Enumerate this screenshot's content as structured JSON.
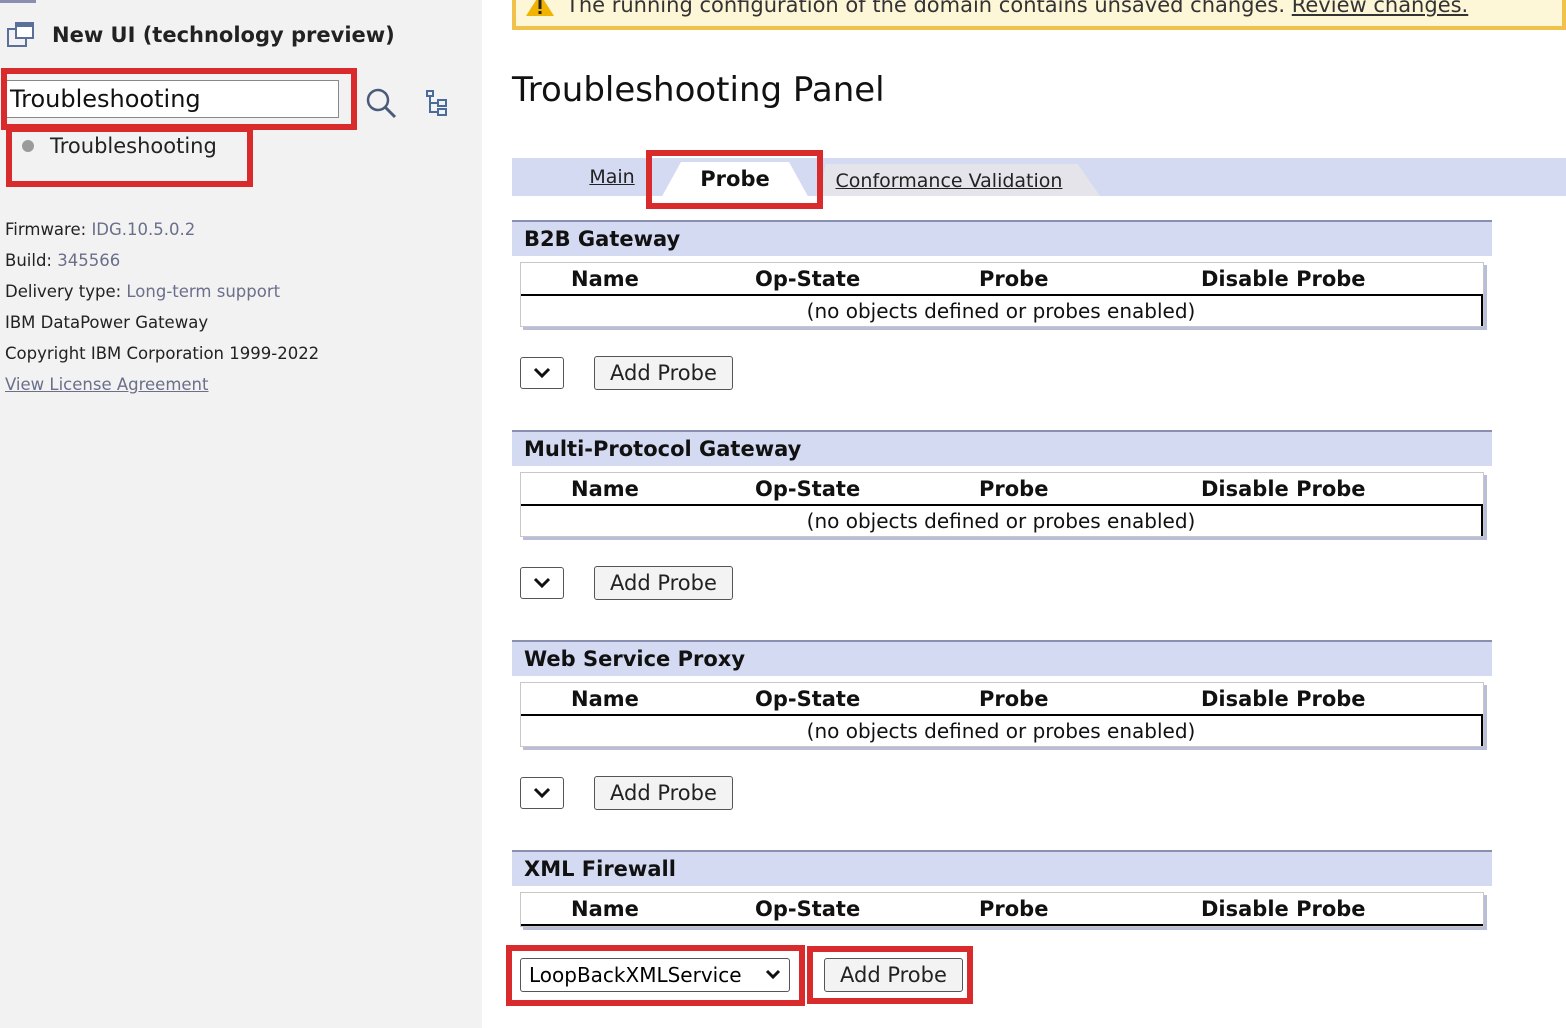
{
  "sidebar": {
    "title": "New UI (technology preview)",
    "search": {
      "value": "Troubleshooting"
    },
    "result_label": "Troubleshooting",
    "info": {
      "firmware_label": "Firmware:",
      "firmware_value": "IDG.10.5.0.2",
      "build_label": "Build:",
      "build_value": "345566",
      "delivery_label": "Delivery type:",
      "delivery_value": "Long-term support",
      "product": "IBM DataPower Gateway",
      "copyright": "Copyright IBM Corporation 1999-2022",
      "license_link": "View License Agreement"
    }
  },
  "banner": {
    "text": "The running configuration of the domain contains unsaved changes.",
    "link": "Review changes."
  },
  "main": {
    "title": "Troubleshooting Panel",
    "tabs": [
      "Main",
      "Probe",
      "Conformance Validation"
    ],
    "active_tab": "Probe",
    "columns": [
      "Name",
      "Op-State",
      "Probe",
      "Disable Probe"
    ],
    "empty_text": "(no objects defined or probes enabled)",
    "add_probe_label": "Add Probe",
    "sections": [
      {
        "title": "B2B Gateway"
      },
      {
        "title": "Multi-Protocol Gateway"
      },
      {
        "title": "Web Service Proxy"
      },
      {
        "title": "XML Firewall",
        "selected_service": "LoopBackXMLService"
      }
    ]
  },
  "colors": {
    "highlight": "#d92b2b",
    "section_header": "#d5daf3",
    "banner_border": "#f0c14b"
  },
  "icons": [
    "window-icon",
    "search-icon",
    "tree-icon",
    "warning-icon",
    "chevron-down-icon"
  ]
}
